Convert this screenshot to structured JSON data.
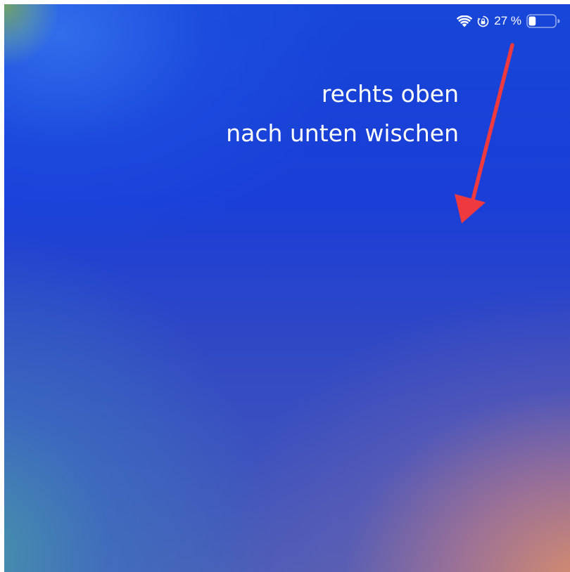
{
  "status_bar": {
    "wifi_icon": "wifi-icon",
    "orientation_lock_icon": "orientation-lock-icon",
    "battery_percent": "27 %",
    "battery_level": 0.27,
    "battery_icon": "battery-icon"
  },
  "instruction": {
    "line1": "rechts oben",
    "line2": "nach unten wischen"
  },
  "colors": {
    "arrow": "#ee3a3f",
    "text": "#ffffff",
    "wallpaper_top": "#1746d8",
    "wallpaper_bottom_right": "#d68c6e"
  }
}
